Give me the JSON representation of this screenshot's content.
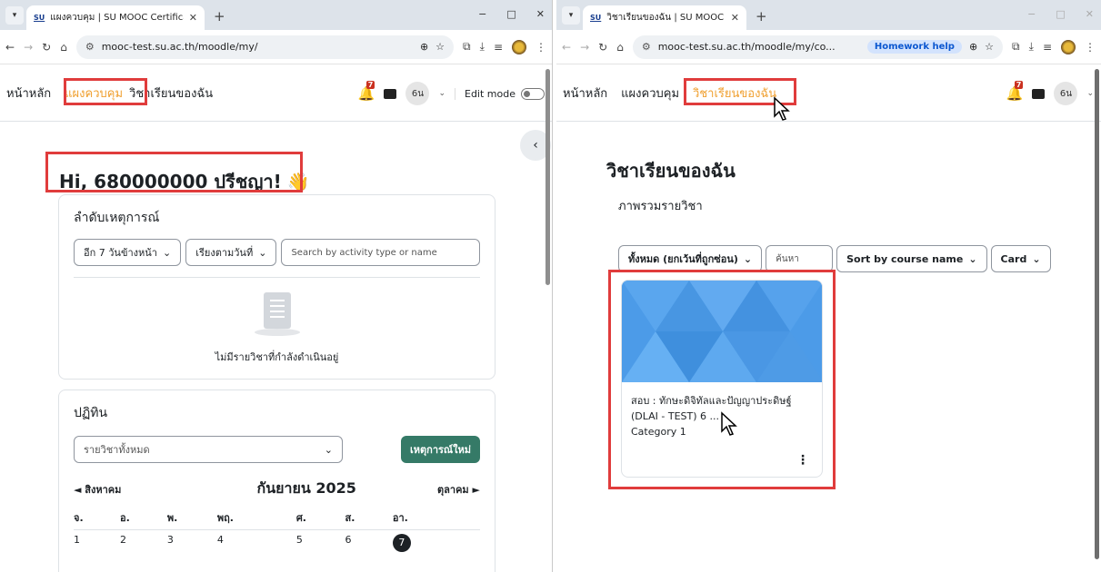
{
  "left_window": {
    "tab_title": "แผงควบคุม | SU MOOC Certificat",
    "favicon": "SU",
    "url": "mooc-test.su.ac.th/moodle/my/",
    "nav": {
      "home": "หน้าหลัก",
      "dashboard": "แผงควบคุม",
      "mycourses": "วิชาเรียนของฉัน"
    },
    "notif_count": "7",
    "avatar_initials": "6น",
    "edit_mode_label": "Edit mode",
    "greeting": "Hi, 680000000 ปรีชญา!",
    "timeline": {
      "title": "ลำดับเหตุการณ์",
      "filter_range": "อีก 7 วันข้างหน้า",
      "sort": "เรียงตามวันที่",
      "search_placeholder": "Search by activity type or name",
      "empty_text": "ไม่มีรายวิชาที่กำลังดำเนินอยู่"
    },
    "calendar": {
      "title": "ปฏิทิน",
      "course_filter": "รายวิชาทั้งหมด",
      "new_event": "เหตุการณ์ใหม่",
      "prev_month": "สิงหาคม",
      "current_month": "กันยายน 2025",
      "next_month": "ตุลาคม",
      "weekdays": [
        "จ.",
        "อ.",
        "พ.",
        "พฤ.",
        "ศ.",
        "ส.",
        "อา."
      ],
      "days": [
        "1",
        "2",
        "3",
        "4",
        "5",
        "6",
        "7"
      ],
      "today": "7"
    }
  },
  "right_window": {
    "tab_title": "วิชาเรียนของฉัน | SU MOOC Certi",
    "favicon": "SU",
    "url": "mooc-test.su.ac.th/moodle/my/co...",
    "homework_help": "Homework help",
    "nav": {
      "home": "หน้าหลัก",
      "dashboard": "แผงควบคุม",
      "mycourses": "วิชาเรียนของฉัน"
    },
    "notif_count": "7",
    "avatar_initials": "6น",
    "page_title": "วิชาเรียนของฉัน",
    "overview_title": "ภาพรวมรายวิชา",
    "filter_all": "ทั้งหมด (ยกเว้นที่ถูกซ่อน)",
    "search_placeholder": "ค้นหา",
    "sort": "Sort by course name",
    "view": "Card",
    "course": {
      "name": "สอบ : ทักษะดิจิทัลและปัญญาประดิษฐ์ (DLAI - TEST) 6 ...",
      "category": "Category 1",
      "menu": "⋮"
    }
  },
  "window_controls": {
    "minimize": "−",
    "maximize": "□",
    "close": "✕"
  },
  "colors": {
    "highlight": "#e03c3c",
    "active_nav": "#f0a030",
    "green_button": "#357a67",
    "course_image": "#4c9be8"
  }
}
